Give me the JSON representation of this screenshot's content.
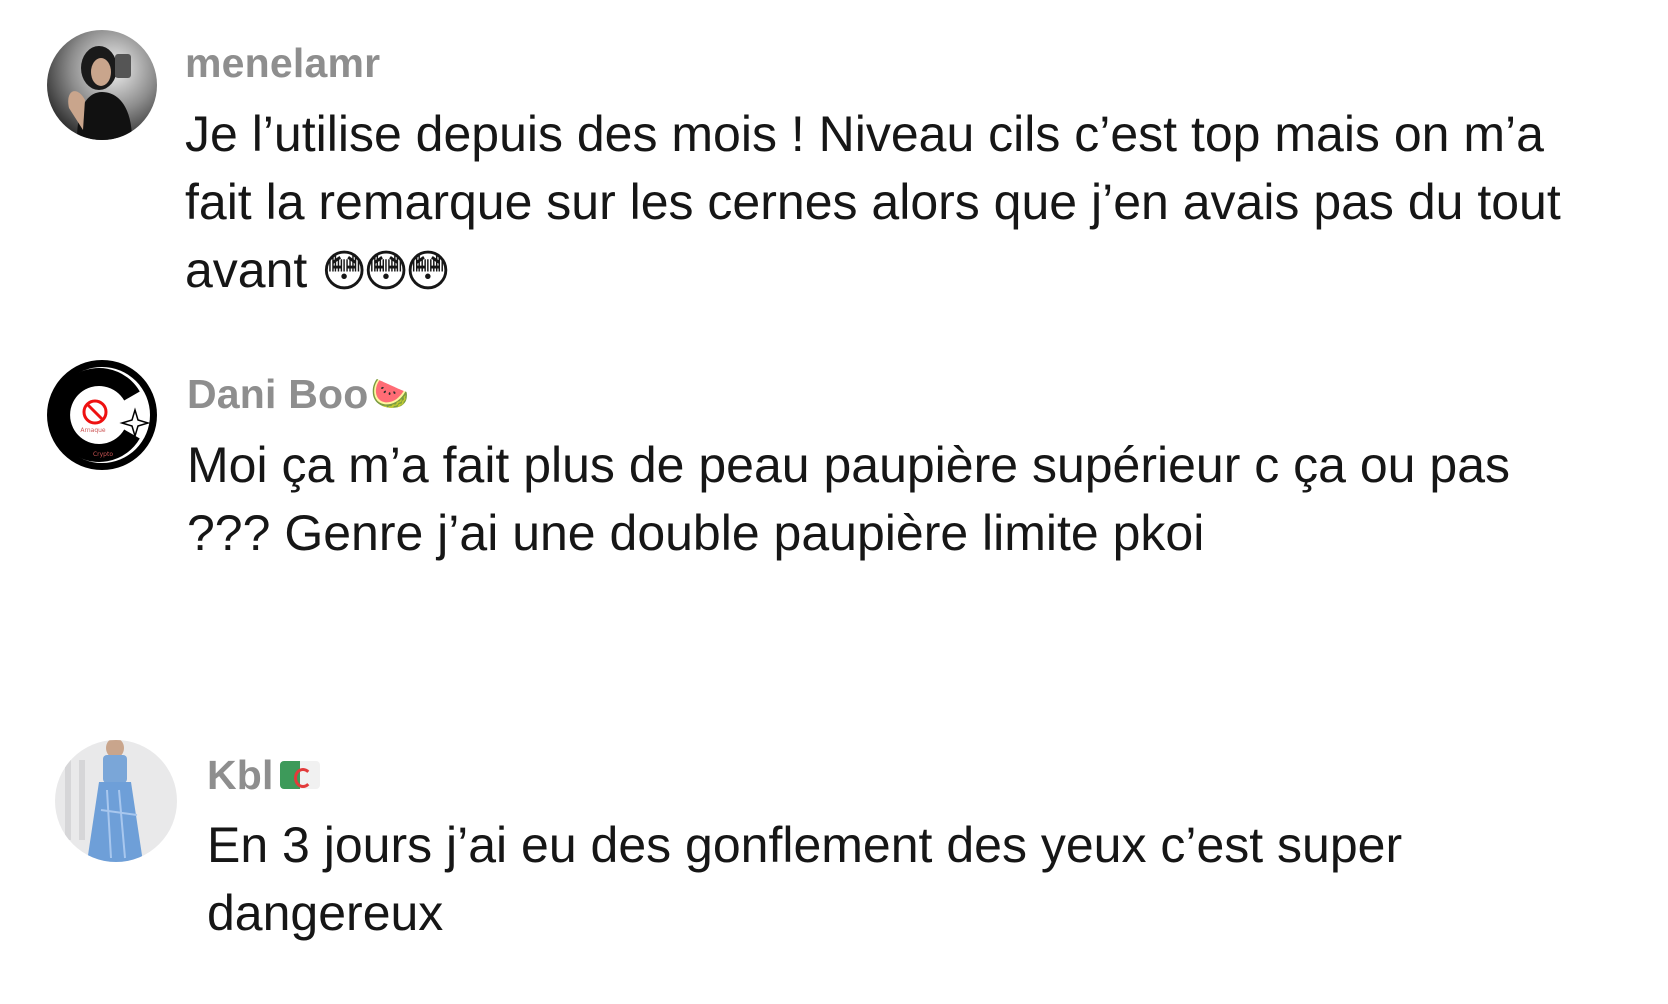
{
  "comments": [
    {
      "username": "menelamr",
      "name_emoji": "",
      "text": "Je l’utilise depuis des mois ! Niveau cils c’est top mais on m’a fait la remarque sur les cernes alors que j’en avais pas du tout avant",
      "emoji": "😳😳😳",
      "avatar_icon": "profile-photo"
    },
    {
      "username": "Dani Boo",
      "name_emoji": "🍉",
      "text": "Moi ça m’a fait plus de peau paupière supérieur c ça ou pas ??? Genre j’ai une double paupière limite pkoi",
      "emoji": "",
      "avatar_icon": "logo",
      "avatar_lines": [
        "Arnaque",
        "Crypto"
      ]
    },
    {
      "username": "Kbl",
      "name_emoji": "🇩🇿",
      "text": "En 3 jours j’ai eu des gonflement des yeux c’est super dangereux",
      "emoji": "",
      "avatar_icon": "profile-photo"
    }
  ],
  "colors": {
    "username": "#8e8e8e",
    "text": "#161616",
    "background": "#ffffff"
  }
}
